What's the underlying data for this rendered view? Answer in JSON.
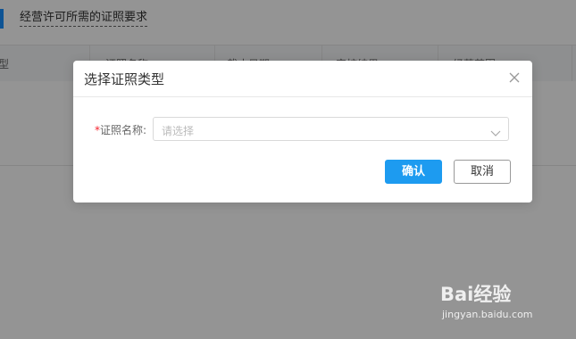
{
  "background": {
    "breadcrumb_link": "经营许可所需的证照要求",
    "columns": [
      "型",
      "证照名称",
      "截止日期",
      "审核结果",
      "经营范围"
    ]
  },
  "modal": {
    "title": "选择证照类型",
    "close_icon": "close-icon",
    "field": {
      "required_mark": "*",
      "label": "证照名称:",
      "placeholder": "请选择"
    },
    "confirm_label": "确认",
    "cancel_label": "取消"
  },
  "watermark": {
    "brand": "Bai经验",
    "url": "jingyan.baidu.com"
  },
  "colors": {
    "primary": "#1d9bf0",
    "required": "#f5222d",
    "overlay": "rgba(0,0,0,0.42)"
  }
}
